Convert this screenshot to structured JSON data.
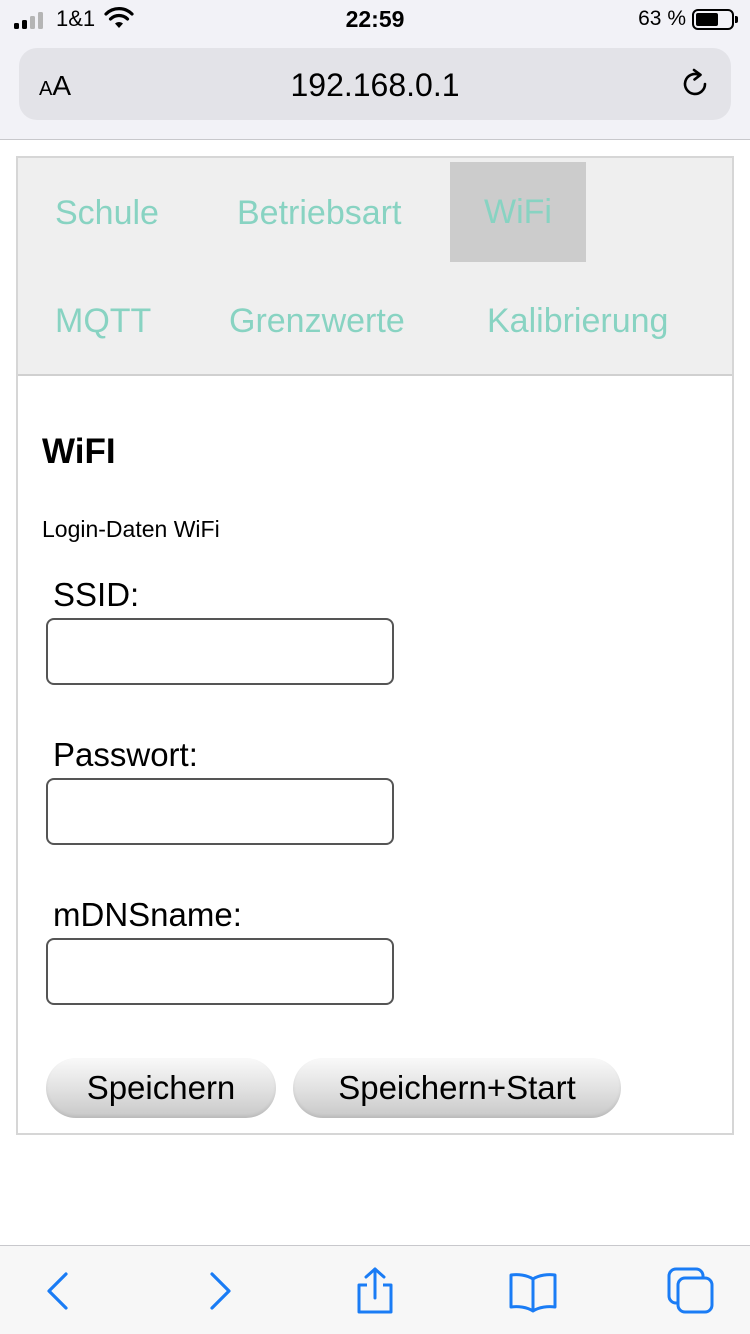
{
  "status_bar": {
    "carrier": "1&1",
    "time": "22:59",
    "battery_percent": "63 %"
  },
  "browser": {
    "text_size_button": {
      "small": "A",
      "large": "A"
    },
    "url": "192.168.0.1",
    "toolbar_icons": [
      "back-icon",
      "forward-icon",
      "share-icon",
      "bookmarks-icon",
      "tabs-icon"
    ]
  },
  "nav": {
    "tabs": [
      {
        "label": "Schule"
      },
      {
        "label": "Betriebsart"
      },
      {
        "label": "WiFi",
        "active": true
      },
      {
        "label": "MQTT"
      },
      {
        "label": "Grenzwerte"
      },
      {
        "label": "Kalibrierung"
      }
    ]
  },
  "form": {
    "title": "WiFI",
    "subtitle": "Login-Daten WiFi",
    "fields": [
      {
        "label": "SSID:",
        "value": ""
      },
      {
        "label": "Passwort:",
        "value": ""
      },
      {
        "label": "mDNSname:",
        "value": ""
      }
    ],
    "buttons": {
      "save": "Speichern",
      "save_start": "Speichern+Start"
    }
  },
  "colors": {
    "tab_text": "#88d3c2",
    "tab_active_bg": "#cccccc",
    "ios_blue": "#1a7cf5"
  }
}
